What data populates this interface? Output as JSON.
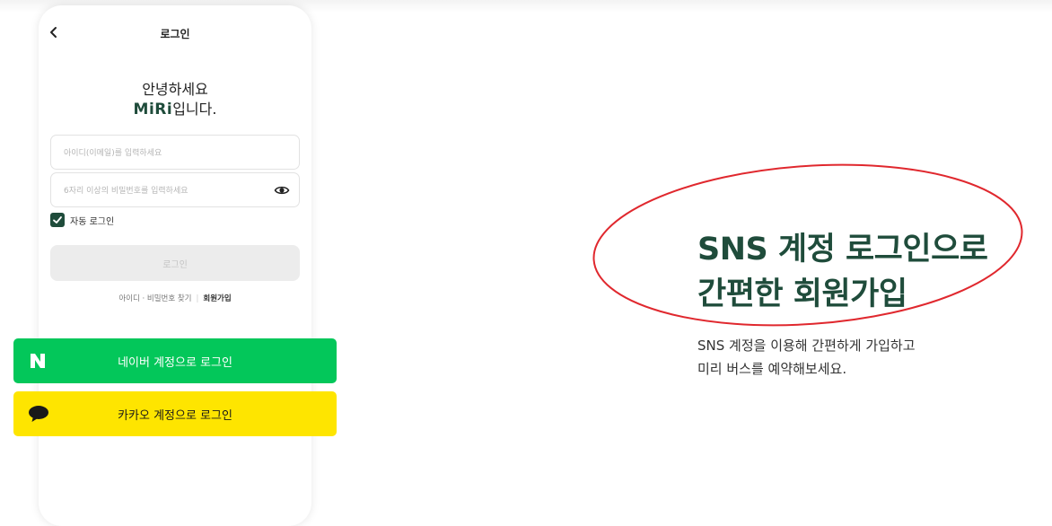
{
  "header": {
    "title": "로그인",
    "back_icon": "chevron-left-icon"
  },
  "greeting": {
    "line1": "안녕하세요",
    "brand": "MiRi",
    "line2_suffix": "입니다."
  },
  "form": {
    "id_placeholder": "아이디(이메일)를 입력하세요",
    "id_value": "",
    "password_placeholder": "6자리 이상의 비밀번호를 입력하세요",
    "password_value": "",
    "eye_icon": "eye-icon",
    "auto_login_label": "자동 로그인",
    "auto_login_checked": true,
    "login_button": "로그인"
  },
  "links": {
    "find": "아이디 · 비밀번호 찾기",
    "signup": "회원가입"
  },
  "sns": {
    "naver_label": "네이버 계정으로 로그인",
    "naver_icon_letter": "N",
    "kakao_label": "카카오 계정으로 로그인",
    "kakao_icon": "speech-bubble-icon"
  },
  "promo": {
    "title_line1": "SNS 계정 로그인으로",
    "title_line2": "간편한 회원가입",
    "desc_line1": "SNS 계정을 이용해 간편하게 가입하고",
    "desc_line2": "미리 버스를 예약해보세요."
  },
  "colors": {
    "brand": "#1f4c3b",
    "naver": "#03c75a",
    "kakao": "#fee500",
    "annotation": "#e0282e"
  }
}
